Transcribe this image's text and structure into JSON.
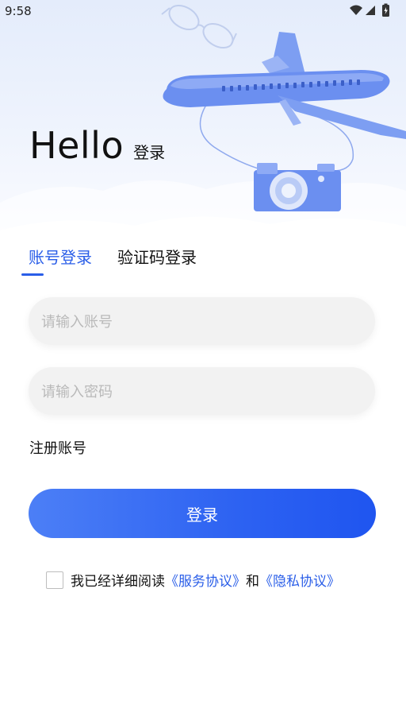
{
  "status_bar": {
    "time": "9:58",
    "icons": [
      "wifi-icon",
      "cellular-signal-icon",
      "battery-charging-icon"
    ]
  },
  "greeting": {
    "title": "Hello",
    "subtitle": "登录"
  },
  "tabs": [
    {
      "label": "账号登录",
      "active": true
    },
    {
      "label": "验证码登录",
      "active": false
    }
  ],
  "form": {
    "account_placeholder": "请输入账号",
    "account_value": "",
    "password_placeholder": "请输入密码",
    "password_value": ""
  },
  "register_link": "注册账号",
  "login_button": "登录",
  "agreement": {
    "checked": false,
    "prefix": "我已经详细阅读",
    "service_link": "《服务协议》",
    "and": "和",
    "privacy_link": "《隐私协议》"
  },
  "colors": {
    "accent": "#2a5ee8",
    "button_start": "#4c7ff6",
    "button_end": "#1f55f0",
    "input_bg": "#f2f2f2",
    "placeholder": "#b9b9b9"
  }
}
